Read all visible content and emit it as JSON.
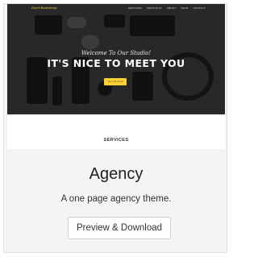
{
  "preview": {
    "brand": "Start Bootstrap",
    "nav_links": [
      "Services",
      "Portfolio",
      "About",
      "Team",
      "Contact"
    ],
    "welcome": "Welcome To Our Studio!",
    "headline": "IT'S NICE TO MEET YOU",
    "cta_label": "Tell me more",
    "section_heading": "SERVICES",
    "accent_color": "#fed136",
    "hero_bg": "#26282a"
  },
  "card": {
    "title": "Agency",
    "description": "A one page agency theme.",
    "button_label": "Preview & Download"
  }
}
